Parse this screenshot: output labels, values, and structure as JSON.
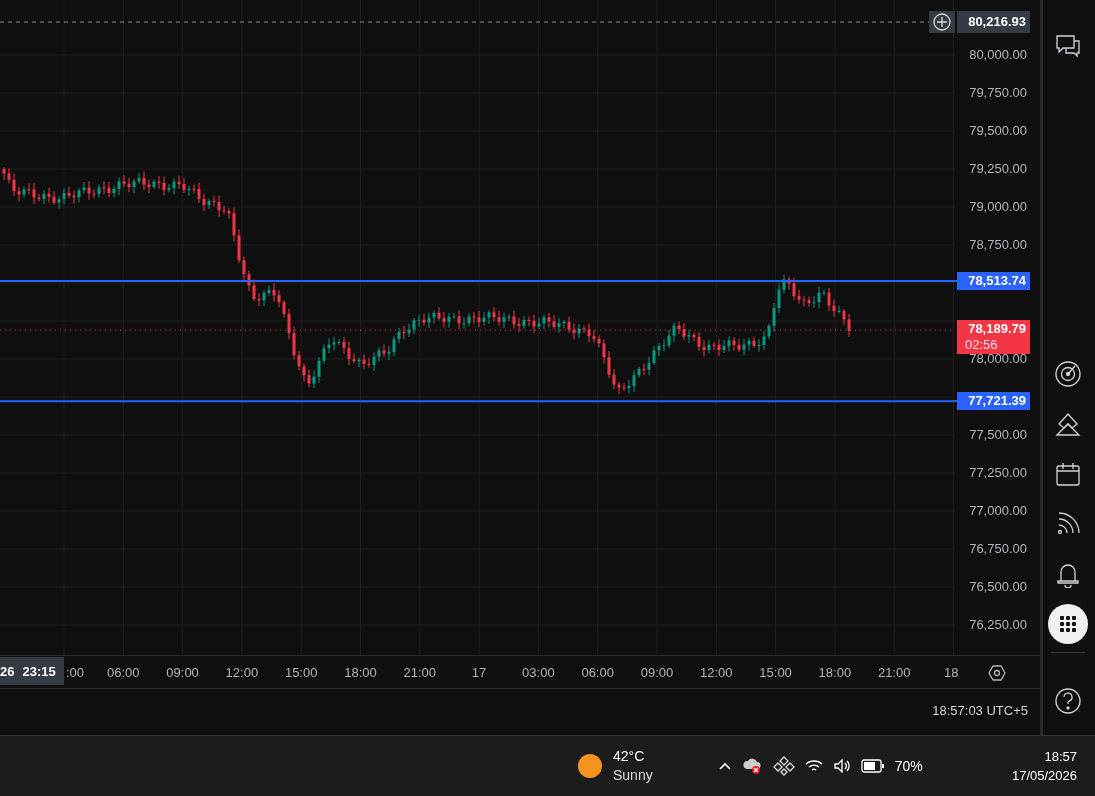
{
  "chart": {
    "crosshair": {
      "price": "80,216.93"
    },
    "price_ticks": [
      "80,000.00",
      "79,750.00",
      "79,500.00",
      "79,250.00",
      "79,000.00",
      "78,750.00",
      "78,000.00",
      "77,500.00",
      "77,250.00",
      "77,000.00",
      "76,750.00",
      "76,500.00",
      "76,250.00"
    ],
    "levels": [
      {
        "price": "78,513.74"
      },
      {
        "price": "77,721.39"
      }
    ],
    "last_price": {
      "price": "78,189.79",
      "countdown": "02:56"
    },
    "time_axis": {
      "crosshair_day": "26",
      "crosshair_time": "23:15",
      "ticks": [
        ":00",
        "06:00",
        "09:00",
        "12:00",
        "15:00",
        "18:00",
        "21:00",
        "17",
        "03:00",
        "06:00",
        "09:00",
        "12:00",
        "15:00",
        "18:00",
        "21:00",
        "18"
      ]
    },
    "clock": "18:57:03 UTC+5"
  },
  "sidebar": {
    "items": [
      {
        "kind": "chat",
        "selected": false
      },
      {
        "kind": "target",
        "selected": false
      },
      {
        "kind": "layers",
        "selected": false
      },
      {
        "kind": "calendar",
        "selected": false
      },
      {
        "kind": "feed",
        "selected": false
      },
      {
        "kind": "bell",
        "selected": false
      },
      {
        "kind": "apps",
        "selected": true
      },
      {
        "kind": "help",
        "selected": false
      }
    ]
  },
  "taskbar": {
    "weather": {
      "temperature": "42°C",
      "condition": "Sunny"
    },
    "battery": "70%",
    "time": "18:57",
    "date": "17/05/2026"
  }
}
